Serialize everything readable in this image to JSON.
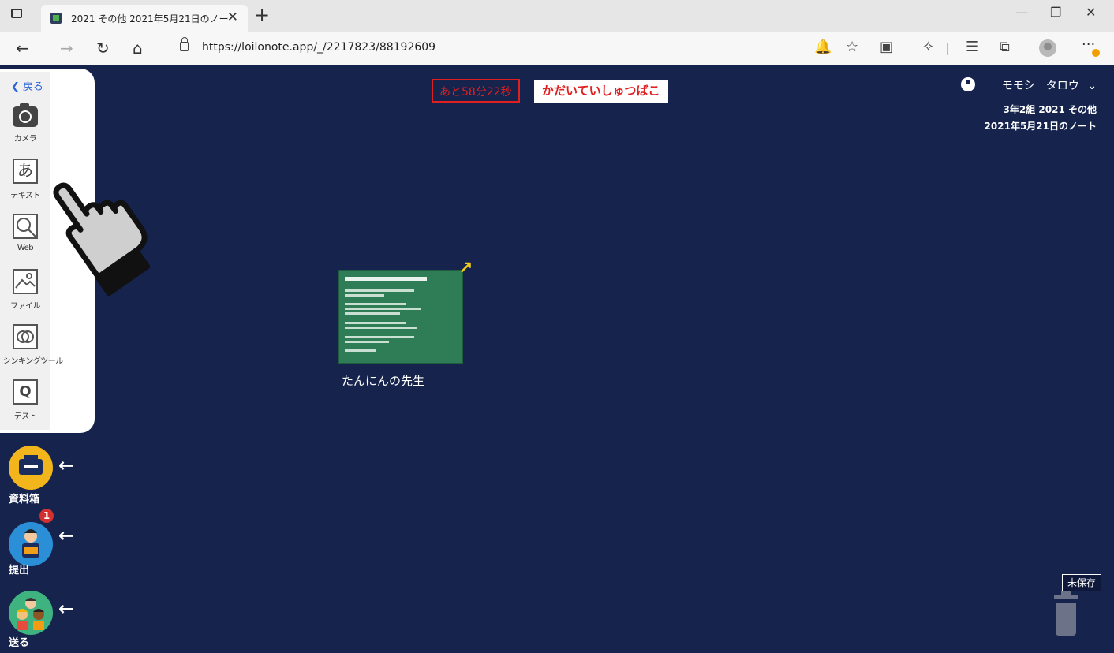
{
  "browser": {
    "tab_title": "2021 その他 2021年5月21日のノート",
    "tab_close": "✕",
    "new_tab": "+",
    "url": "https://loilonote.app/_/2217823/88192609",
    "win_min": "—",
    "win_max": "❐",
    "win_close": "✕",
    "more": "···"
  },
  "toolbar": {
    "back_label": "戻る",
    "tools": [
      {
        "label": "カメラ"
      },
      {
        "label": "テキスト",
        "glyph": "あ"
      },
      {
        "label": "Web"
      },
      {
        "label": "ファイル"
      },
      {
        "label": "シンキングツール"
      },
      {
        "label": "テスト",
        "glyph": "Q"
      }
    ]
  },
  "header": {
    "timer": "あと58分22秒",
    "subject": "かだいていしゅつばこ"
  },
  "user": {
    "name": "モモシ　タロウ",
    "class": "3年2組 2021 その他",
    "note": "2021年5月21日のノート"
  },
  "card": {
    "label": "たんにんの先生"
  },
  "side": {
    "materials": "資料箱",
    "submit": "提出",
    "submit_badge": "1",
    "send": "送る"
  },
  "trash": {
    "unsaved": "未保存"
  },
  "colors": {
    "canvas": "#15234d",
    "accent_red": "#e02020",
    "card_green": "#2e7d57",
    "arrow_yellow": "#f2cc1b"
  }
}
